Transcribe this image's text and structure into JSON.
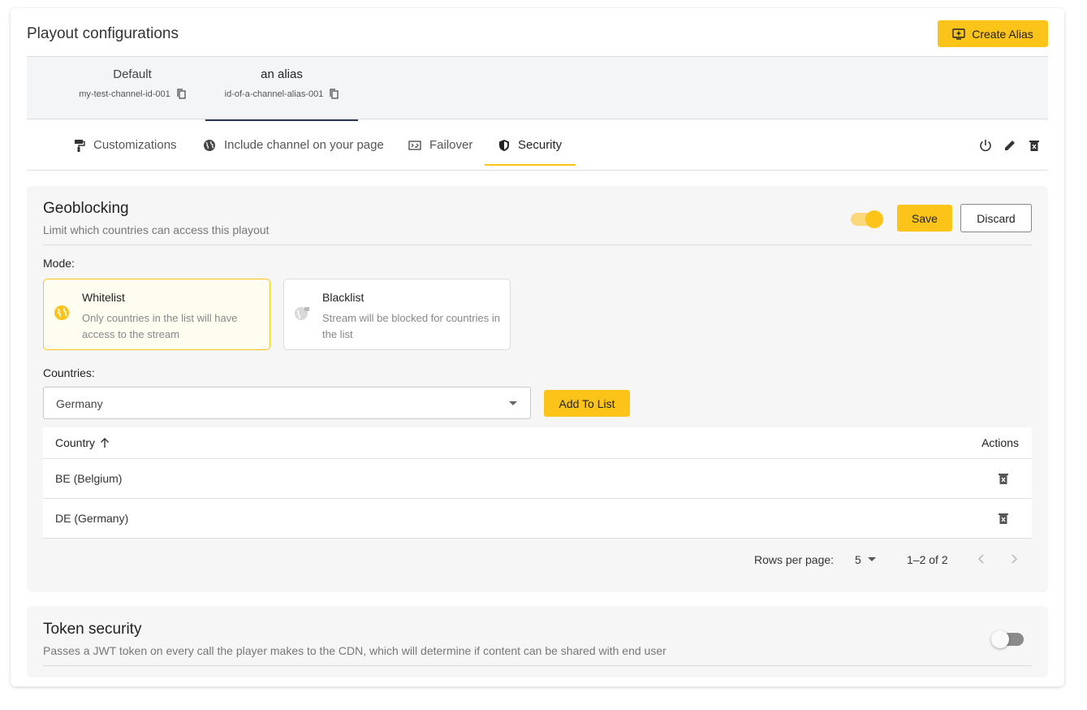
{
  "header": {
    "title": "Playout configurations",
    "create_alias_label": "Create Alias"
  },
  "aliases": [
    {
      "name": "Default",
      "id": "my-test-channel-id-001",
      "active": false
    },
    {
      "name": "an alias",
      "id": "id-of-a-channel-alias-001",
      "active": true
    }
  ],
  "tabs": [
    {
      "label": "Customizations",
      "icon": "paint-roller-icon"
    },
    {
      "label": "Include channel on your page",
      "icon": "globe-icon"
    },
    {
      "label": "Failover",
      "icon": "failover-icon"
    },
    {
      "label": "Security",
      "icon": "shield-icon",
      "active": true
    }
  ],
  "tab_actions": [
    "power-icon",
    "edit-icon",
    "delete-icon"
  ],
  "geoblocking": {
    "title": "Geoblocking",
    "subtitle": "Limit which countries can access this playout",
    "enabled": true,
    "save_label": "Save",
    "discard_label": "Discard",
    "mode_label": "Mode:",
    "modes": [
      {
        "title": "Whitelist",
        "description": "Only countries in the list will have access to the stream",
        "selected": true
      },
      {
        "title": "Blacklist",
        "description": "Stream will be blocked for countries in the list",
        "selected": false
      }
    ],
    "countries_label": "Countries:",
    "country_select_value": "Germany",
    "add_label": "Add To List",
    "table": {
      "col_country": "Country",
      "col_actions": "Actions",
      "rows": [
        "BE (Belgium)",
        "DE (Germany)"
      ]
    },
    "pagination": {
      "rows_per_page_label": "Rows per page:",
      "rows_per_page": "5",
      "range": "1–2 of 2"
    }
  },
  "token_security": {
    "title": "Token security",
    "subtitle": "Passes a JWT token on every call the player makes to the CDN, which will determine if content can be shared with end user",
    "enabled": false
  },
  "colors": {
    "accent": "#fcc419",
    "tab_underline_alias": "#2a3a55"
  }
}
